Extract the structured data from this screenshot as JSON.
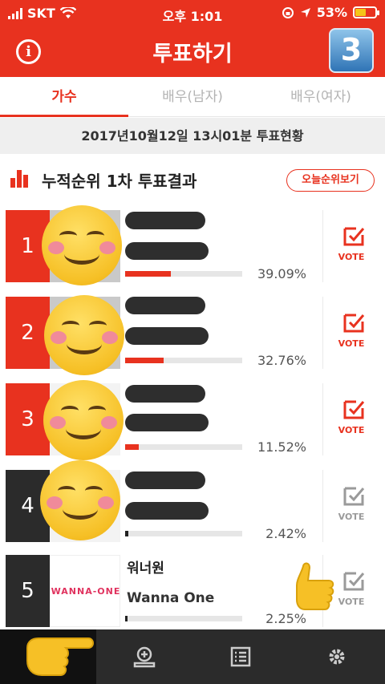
{
  "status": {
    "carrier": "SKT",
    "time": "오후 1:01",
    "battery": "53%"
  },
  "header": {
    "title": "투표하기",
    "info_icon": "info-icon",
    "badge": "3"
  },
  "tabs": [
    {
      "label": "가수",
      "active": true
    },
    {
      "label": "배우(남자)",
      "active": false
    },
    {
      "label": "배우(여자)",
      "active": false
    }
  ],
  "date_text": "2017년10월12일 13시01분 투표현황",
  "section": {
    "title": "누적순위 1차 투표결과",
    "today_button": "오늘순위보기"
  },
  "rankings": [
    {
      "rank": "1",
      "name": "",
      "subname": "",
      "percent_text": "39.09%",
      "percent": 39.09
    },
    {
      "rank": "2",
      "name": "",
      "subname": "",
      "percent_text": "32.76%",
      "percent": 32.76
    },
    {
      "rank": "3",
      "name": "",
      "subname": "",
      "percent_text": "11.52%",
      "percent": 11.52
    },
    {
      "rank": "4",
      "name": "",
      "subname": "",
      "percent_text": "2.42%",
      "percent": 2.42
    },
    {
      "rank": "5",
      "name": "워너원",
      "subname": "Wanna One",
      "logo_text": "WANNA-ONE",
      "percent_text": "2.25%",
      "percent": 2.25
    }
  ],
  "vote_label": "VOTE",
  "colors": {
    "accent": "#e8321f",
    "dark": "#2b2b2b"
  },
  "bottom_nav": [
    {
      "icon": "vote-check-icon",
      "active": true
    },
    {
      "icon": "add-award-icon",
      "active": false
    },
    {
      "icon": "list-icon",
      "active": false
    },
    {
      "icon": "settings-gear-icon",
      "active": false
    }
  ]
}
